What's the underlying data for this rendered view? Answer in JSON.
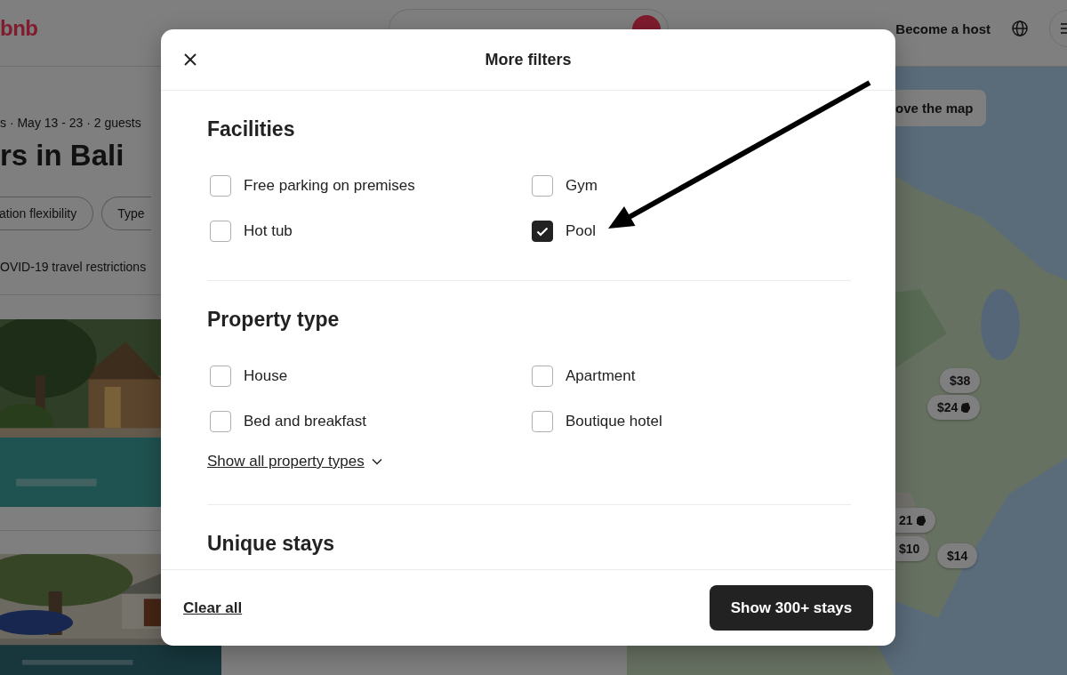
{
  "header": {
    "logo": "bnb",
    "host_link": "Become a host"
  },
  "listing": {
    "subtitle": "s · May 13 - 23 · 2 guests",
    "title": "rs in Bali",
    "filters": [
      "ation flexibility",
      "Type"
    ],
    "notice": "OVID-19 travel restrictions",
    "items": [
      {
        "kind": "picture"
      },
      {
        "kind": "picture"
      }
    ]
  },
  "map": {
    "button": "ove the map",
    "pins": [
      {
        "label": "$38",
        "tagged": false
      },
      {
        "label": "$24",
        "tagged": true
      },
      {
        "label": "21",
        "tagged": true
      },
      {
        "label": "$10",
        "tagged": false
      },
      {
        "label": "$14",
        "tagged": false
      }
    ]
  },
  "modal": {
    "title": "More filters",
    "sections": [
      {
        "title": "Facilities",
        "options": [
          {
            "label": "Free parking on premises",
            "checked": false
          },
          {
            "label": "Gym",
            "checked": false
          },
          {
            "label": "Hot tub",
            "checked": false
          },
          {
            "label": "Pool",
            "checked": true
          }
        ]
      },
      {
        "title": "Property type",
        "options": [
          {
            "label": "House",
            "checked": false
          },
          {
            "label": "Apartment",
            "checked": false
          },
          {
            "label": "Bed and breakfast",
            "checked": false
          },
          {
            "label": "Boutique hotel",
            "checked": false
          }
        ],
        "link": "Show all property types"
      },
      {
        "title": "Unique stays"
      }
    ],
    "clear": "Clear all",
    "submit": "Show 300+ stays"
  },
  "annotations": [
    {
      "kind": "arrow"
    }
  ]
}
